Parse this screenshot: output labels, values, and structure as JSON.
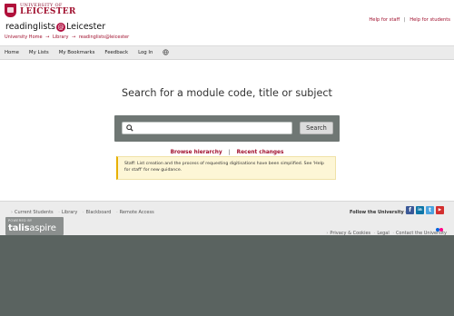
{
  "header": {
    "logo_small": "UNIVERSITY OF",
    "logo_big": "LEICESTER",
    "site_title_pre": "readinglists",
    "site_title_at": "@",
    "site_title_post": "Leicester",
    "breadcrumb": [
      "University Home",
      "→",
      "Library",
      "→",
      "readinglists@leicester"
    ],
    "help_staff": "Help for staff",
    "help_sep": "|",
    "help_students": "Help for students"
  },
  "nav": {
    "items": [
      "Home",
      "My Lists",
      "My Bookmarks",
      "Feedback",
      "Log In"
    ],
    "lang_icon": "language-icon"
  },
  "main": {
    "headline": "Search for a module code, title or subject",
    "search_placeholder": "",
    "search_button": "Search",
    "browse_link": "Browse hierarchy",
    "links_sep": "|",
    "recent_link": "Recent changes",
    "notice_text": "Staff: List creation and the process of requesting digitisations have been simplified. See 'Help for staff' for new guidance."
  },
  "footer": {
    "links": [
      "Current Students",
      "Library",
      "Blackboard",
      "Remote Access"
    ],
    "powered_by": "POWERED BY",
    "talis_brand_a": "talis",
    "talis_brand_b": "aspire",
    "follow_text": "Follow the University on",
    "social": [
      {
        "name": "facebook-icon",
        "glyph": "f",
        "color": "#3b5998"
      },
      {
        "name": "linkedin-icon",
        "glyph": "in",
        "color": "#0e76a8"
      },
      {
        "name": "twitter-icon",
        "glyph": "t",
        "color": "#4aa3df"
      },
      {
        "name": "youtube-icon",
        "glyph": "▶",
        "color": "#d32f2f"
      }
    ],
    "right_links": [
      "Privacy & Cookies",
      "Legal",
      "Contact the University"
    ]
  },
  "colors": {
    "brand": "#a0102e",
    "search_bg": "#6f7774",
    "bottom_band": "#5a6360",
    "notice_bg": "#fdf6d6"
  }
}
